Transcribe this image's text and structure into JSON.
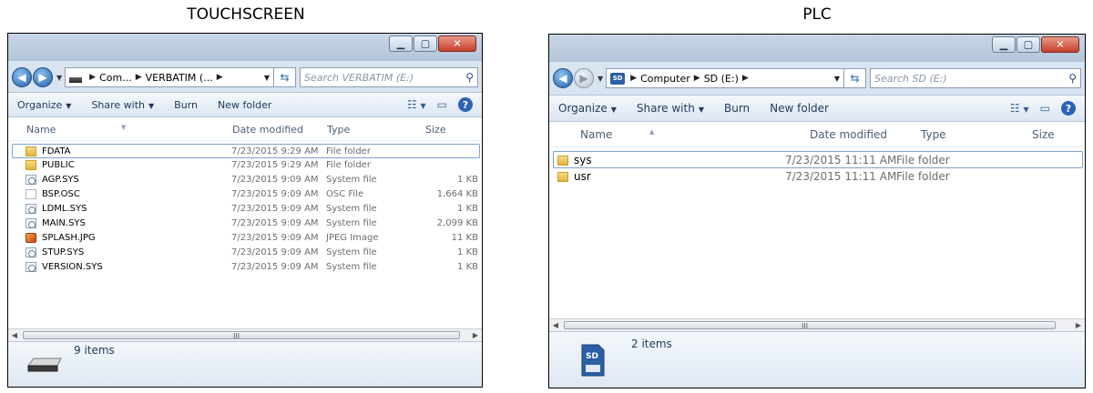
{
  "captions": {
    "left": "TOUCHSCREEN",
    "right": "PLC"
  },
  "left_window": {
    "breadcrumb": [
      "Com...",
      "VERBATIM (..."
    ],
    "search_placeholder": "Search VERBATIM (E:)",
    "commands": [
      "Organize",
      "Share with",
      "Burn",
      "New folder"
    ],
    "columns": [
      "Name",
      "Date modified",
      "Type",
      "Size"
    ],
    "files": [
      {
        "name": "FDATA",
        "date": "7/23/2015 9:29 AM",
        "type": "File folder",
        "size": "",
        "icon": "folder-icon"
      },
      {
        "name": "PUBLIC",
        "date": "7/23/2015 9:29 AM",
        "type": "File folder",
        "size": "",
        "icon": "folder-icon"
      },
      {
        "name": "AGP.SYS",
        "date": "7/23/2015 9:09 AM",
        "type": "System file",
        "size": "1 KB",
        "icon": "system-file-icon"
      },
      {
        "name": "BSP.OSC",
        "date": "7/23/2015 9:09 AM",
        "type": "OSC File",
        "size": "1,664 KB",
        "icon": "file-icon"
      },
      {
        "name": "LDML.SYS",
        "date": "7/23/2015 9:09 AM",
        "type": "System file",
        "size": "1 KB",
        "icon": "system-file-icon"
      },
      {
        "name": "MAIN.SYS",
        "date": "7/23/2015 9:09 AM",
        "type": "System file",
        "size": "2,099 KB",
        "icon": "system-file-icon"
      },
      {
        "name": "SPLASH.JPG",
        "date": "7/23/2015 9:09 AM",
        "type": "JPEG Image",
        "size": "11 KB",
        "icon": "jpeg-icon"
      },
      {
        "name": "STUP.SYS",
        "date": "7/23/2015 9:09 AM",
        "type": "System file",
        "size": "1 KB",
        "icon": "system-file-icon"
      },
      {
        "name": "VERSION.SYS",
        "date": "7/23/2015 9:09 AM",
        "type": "System file",
        "size": "1 KB",
        "icon": "system-file-icon"
      }
    ],
    "item_count": "9 items"
  },
  "right_window": {
    "breadcrumb": [
      "Computer",
      "SD (E:)"
    ],
    "drive_badge": "SD",
    "search_placeholder": "Search SD (E:)",
    "commands": [
      "Organize",
      "Share with",
      "Burn",
      "New folder"
    ],
    "columns": [
      "Name",
      "Date modified",
      "Type",
      "Size"
    ],
    "files": [
      {
        "name": "sys",
        "date": "7/23/2015 11:11 AM",
        "type": "File folder",
        "size": "",
        "icon": "folder-icon"
      },
      {
        "name": "usr",
        "date": "7/23/2015 11:11 AM",
        "type": "File folder",
        "size": "",
        "icon": "folder-icon"
      }
    ],
    "item_count": "2 items",
    "sd_card_label": "SD"
  },
  "scroll_grip": "III",
  "colors": {
    "title_bar": "#b4c5d9",
    "close_button": "#c4402a",
    "command_text": "#1e395b",
    "selection_border": "#7da2ce"
  }
}
